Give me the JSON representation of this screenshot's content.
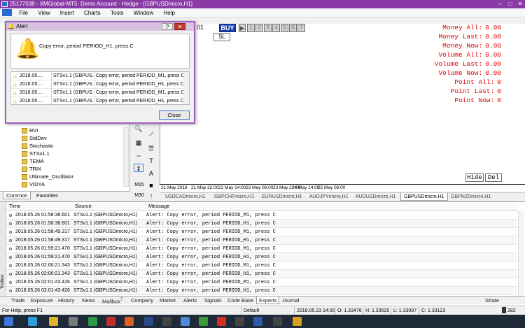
{
  "window": {
    "title": "25177038 - XMGlobal-MT5: Demo Account - Hedge - [GBPUSDmicro,H1]"
  },
  "menu": [
    "File",
    "View",
    "Insert",
    "Charts",
    "Tools",
    "Window",
    "Help"
  ],
  "toolbar": {
    "price_fragment": "01",
    "buy_label": "BUY",
    "sl_label": "SL",
    "lot_digits": [
      "1",
      "2",
      "3",
      "4",
      "5",
      "6",
      "7"
    ]
  },
  "chart_info": [
    {
      "label": "Money All:",
      "value": "0.00"
    },
    {
      "label": "Money Last:",
      "value": "0.00"
    },
    {
      "label": "Money Now:",
      "value": "0.00"
    },
    {
      "label": "Volume All:",
      "value": "0.00"
    },
    {
      "label": "Volume Last:",
      "value": "0.00"
    },
    {
      "label": "Volume Now:",
      "value": "0.00"
    },
    {
      "label": "Point All:",
      "value": "0"
    },
    {
      "label": "Point Last:",
      "value": "0"
    },
    {
      "label": "Point Now:",
      "value": "0"
    }
  ],
  "chart_buttons": {
    "hide": "Hide",
    "del": "Del"
  },
  "time_axis": [
    "21 May 2018",
    "21 May 22:00",
    "22 May 14:00",
    "23 May 06:00",
    "23 May 22:00",
    "24 May 14:00",
    "25 May 06:00"
  ],
  "chart_tabs": [
    "USDCADmicro,H1",
    "GBPCHFmicro,H1",
    "EURUSDmicro,H1",
    "AUDJPYmicro,H1",
    "AUDUSDmicro,H1",
    "GBPUSDmicro,H1",
    "GBPNZDmicro,H1"
  ],
  "active_chart_tab": "GBPUSDmicro,H1",
  "navigator": {
    "items": [
      "RVI",
      "StdDev",
      "Stochastic",
      "STSv1.1",
      "TEMA",
      "TRIX",
      "Ultimate_Oscillator",
      "VIDYA"
    ],
    "tabs": [
      "Common",
      "Favorites"
    ]
  },
  "timeframes": [
    "M15",
    "M30"
  ],
  "alert": {
    "title": "Alert",
    "message": "Copy error, period PERIOD_H1, press C",
    "rows": [
      {
        "time": "2018.05....",
        "source": "STSv1.1 (GBPUS...",
        "msg": "Copy error, period PERIOD_M1, press C"
      },
      {
        "time": "2018.05....",
        "source": "STSv1.1 (GBPUS...",
        "msg": "Copy error, period PERIOD_H1, press C"
      },
      {
        "time": "2018.05....",
        "source": "STSv1.1 (GBPUS...",
        "msg": "Copy error, period PERIOD_M1, press C"
      },
      {
        "time": "2018.05....",
        "source": "STSv1.1 (GBPUS...",
        "msg": "Copy error, period PERIOD_H1, press C"
      }
    ],
    "close_label": "Close"
  },
  "toolbox": {
    "headers": {
      "time": "Time",
      "source": "Source",
      "message": "Message"
    },
    "rows": [
      {
        "time": "2018.05.26 01:58:38.601",
        "source": "STSv1.1 (GBPUSDmicro,H1)",
        "msg": "Alert: Copy error, period PERIOD_M1, press C"
      },
      {
        "time": "2018.05.26 01:58:38.601",
        "source": "STSv1.1 (GBPUSDmicro,H1)",
        "msg": "Alert: Copy error, period PERIOD_H1, press C"
      },
      {
        "time": "2018.05.26 01:58:49.317",
        "source": "STSv1.1 (GBPUSDmicro,H1)",
        "msg": "Alert: Copy error, period PERIOD_M1, press C"
      },
      {
        "time": "2018.05.26 01:58:49.317",
        "source": "STSv1.1 (GBPUSDmicro,H1)",
        "msg": "Alert: Copy error, period PERIOD_H1, press C"
      },
      {
        "time": "2018.05.26 01:59:21.470",
        "source": "STSv1.1 (GBPUSDmicro,H1)",
        "msg": "Alert: Copy error, period PERIOD_M1, press C"
      },
      {
        "time": "2018.05.26 01:59:21.470",
        "source": "STSv1.1 (GBPUSDmicro,H1)",
        "msg": "Alert: Copy error, period PERIOD_H1, press C"
      },
      {
        "time": "2018.05.26 02:00:21.343",
        "source": "STSv1.1 (GBPUSDmicro,H1)",
        "msg": "Alert: Copy error, period PERIOD_M1, press C"
      },
      {
        "time": "2018.05.26 02:00:21.343",
        "source": "STSv1.1 (GBPUSDmicro,H1)",
        "msg": "Alert: Copy error, period PERIOD_H1, press C"
      },
      {
        "time": "2018.05.26 02:01:43.426",
        "source": "STSv1.1 (GBPUSDmicro,H1)",
        "msg": "Alert: Copy error, period PERIOD_M1, press C"
      },
      {
        "time": "2018.05.26 02:01:43.426",
        "source": "STSv1.1 (GBPUSDmicro,H1)",
        "msg": "Alert: Copy error, period PERIOD_H1, press C"
      }
    ],
    "side_label": "Toolbox",
    "tabs": [
      "Trade",
      "Exposure",
      "History",
      "News",
      "Mailbox",
      "Company",
      "Market",
      "Alerts",
      "Signals",
      "Code Base",
      "Experts",
      "Journal"
    ],
    "mailbox_badge": "7",
    "active_tab": "Experts",
    "strategy_label": "Strate"
  },
  "status": {
    "help": "For Help, press F1",
    "profile": "Default",
    "datetime": "2018.05.23 14:00",
    "open": "O: 1.33476",
    "high": "H: 1.33520",
    "low": "L: 1.33097",
    "close": "C: 1.33123",
    "right": "282"
  },
  "colors": {
    "title_bar": "#8a3aa6",
    "info_text": "#e00000",
    "buy_button": "#1a3fb0"
  }
}
